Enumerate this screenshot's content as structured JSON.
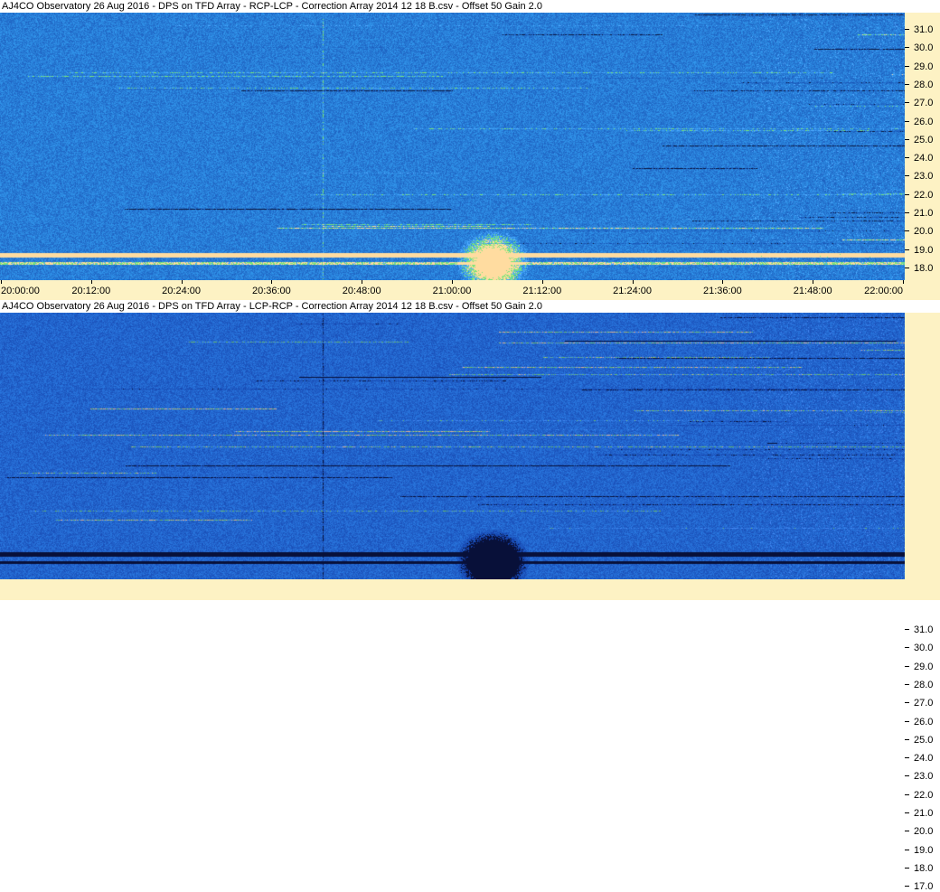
{
  "panels": [
    {
      "title": "AJ4CO Observatory 26 Aug 2016  -  DPS on TFD Array  -  RCP-LCP  -  Correction Array 2014 12 18 B.csv  -  Offset 50  Gain 2.0",
      "polarity": "RCP-LCP"
    },
    {
      "title": "AJ4CO Observatory 26 Aug 2016  -  DPS on TFD Array  -  LCP-RCP  -  Correction Array 2014 12 18 B.csv  -  Offset 50  Gain 2.0",
      "polarity": "LCP-RCP"
    }
  ],
  "frequency_ticks": [
    "31.0",
    "30.0",
    "29.0",
    "28.0",
    "27.0",
    "26.0",
    "25.0",
    "24.0",
    "23.0",
    "22.0",
    "21.0",
    "20.0",
    "19.0",
    "18.0",
    "17.0"
  ],
  "time_ticks": [
    "20:00:00",
    "20:12:00",
    "20:24:00",
    "20:36:00",
    "20:48:00",
    "21:00:00",
    "21:12:00",
    "21:24:00",
    "21:36:00",
    "21:48:00",
    "22:00:00"
  ],
  "colors": {
    "background_blue": "#2a5fd8",
    "axis_bg": "#fdf2c4"
  }
}
